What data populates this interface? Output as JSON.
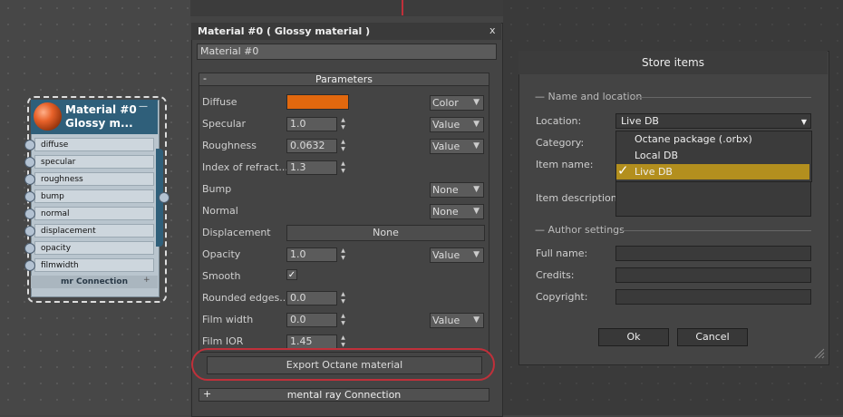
{
  "node": {
    "title_line1": "Material #0",
    "title_line2": "Glossy m...",
    "minimize": "—",
    "slots": [
      "diffuse",
      "specular",
      "roughness",
      "bump",
      "normal",
      "displacement",
      "opacity",
      "filmwidth"
    ],
    "connection": "mr Connection",
    "connection_plus": "+"
  },
  "panel": {
    "title": "Material #0  ( Glossy material )",
    "close": "x",
    "name_value": "Material #0",
    "params_toggle": "-",
    "params_title": "Parameters",
    "diffuse": {
      "label": "Diffuse",
      "color": "#e2680e",
      "type": "Color"
    },
    "specular": {
      "label": "Specular",
      "value": "1.0",
      "type": "Value"
    },
    "roughness": {
      "label": "Roughness",
      "value": "0.0632",
      "type": "Value"
    },
    "ior": {
      "label": "Index of refract...",
      "value": "1.3"
    },
    "bump": {
      "label": "Bump",
      "type": "None"
    },
    "normal": {
      "label": "Normal",
      "type": "None"
    },
    "displacement": {
      "label": "Displacement",
      "button": "None"
    },
    "opacity": {
      "label": "Opacity",
      "value": "1.0",
      "type": "Value"
    },
    "smooth": {
      "label": "Smooth",
      "checked": "✓"
    },
    "rounded": {
      "label": "Rounded edges...",
      "value": "0.0"
    },
    "filmwidth": {
      "label": "Film width",
      "value": "0.0",
      "type": "Value"
    },
    "filmior": {
      "label": "Film IOR",
      "value": "1.45"
    },
    "export_button": "Export Octane material",
    "mr_toggle": "+",
    "mr_title": "mental ray Connection"
  },
  "dialog": {
    "title": "Store items",
    "section1": "Name and location",
    "location_label": "Location:",
    "location_value": "Live DB",
    "category_label": "Category:",
    "itemname_label": "Item name:",
    "itemdesc_label": "Item description:",
    "menu": [
      "Octane package (.orbx)",
      "Local DB",
      "Live DB"
    ],
    "menu_check": "✓",
    "section2": "Author settings",
    "fullname_label": "Full name:",
    "credits_label": "Credits:",
    "copyright_label": "Copyright:",
    "ok": "Ok",
    "cancel": "Cancel"
  },
  "colors": {
    "accent_red": "#c0303a",
    "menu_highlight": "#b38f1e",
    "node_header": "#2f5f7a"
  }
}
